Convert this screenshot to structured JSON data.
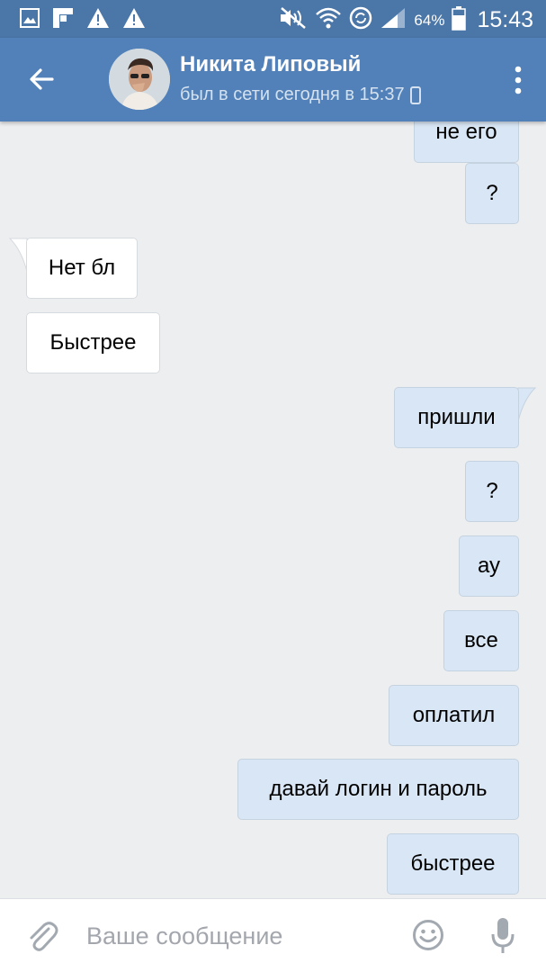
{
  "status_bar": {
    "battery_percent": "64%",
    "time": "15:43",
    "left_icons": [
      "gallery-icon",
      "flipboard-icon",
      "warning-icon",
      "warning-icon"
    ],
    "right_icons": [
      "mute-icon",
      "wifi-icon",
      "sync-icon",
      "signal-icon",
      "battery-icon"
    ]
  },
  "header": {
    "contact_name": "Никита Липовый",
    "contact_status": "был в сети сегодня в 15:37",
    "status_device_icon": "mobile-icon",
    "back_icon": "arrow-left-icon",
    "menu_icon": "more-vertical-icon"
  },
  "messages": [
    {
      "direction": "out",
      "text": "не его"
    },
    {
      "direction": "out",
      "text": "?"
    },
    {
      "direction": "in",
      "text": "Нет бл"
    },
    {
      "direction": "in",
      "text": "Быстрее"
    },
    {
      "direction": "out",
      "text": "пришли"
    },
    {
      "direction": "out",
      "text": "?"
    },
    {
      "direction": "out",
      "text": "ау"
    },
    {
      "direction": "out",
      "text": "все"
    },
    {
      "direction": "out",
      "text": "оплатил"
    },
    {
      "direction": "out",
      "text": "давай логин и пароль"
    },
    {
      "direction": "out",
      "text": "быстрее"
    }
  ],
  "composer": {
    "placeholder": "Ваше сообщение",
    "attach_icon": "paperclip-icon",
    "emoji_icon": "smiley-icon",
    "mic_icon": "microphone-icon"
  },
  "colors": {
    "header_bg": "#5181b8",
    "statusbar_bg": "#4a76a8",
    "chat_bg": "#edeef0",
    "outgoing_bubble": "#d9e6f5",
    "incoming_bubble": "#ffffff"
  }
}
